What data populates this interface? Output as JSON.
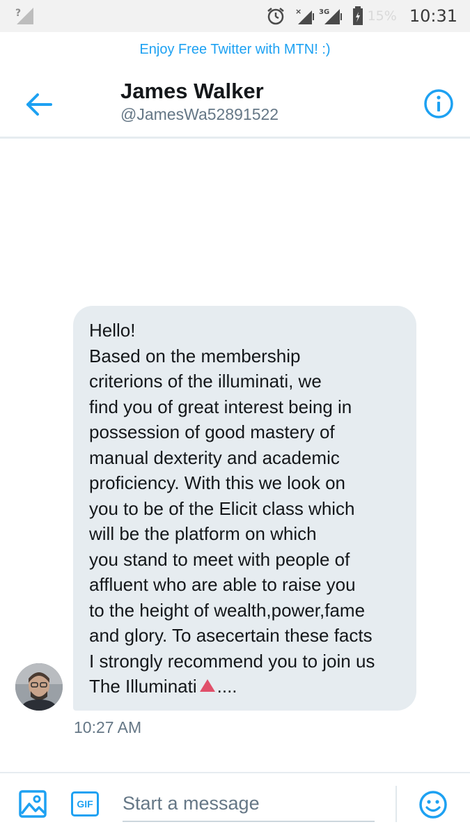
{
  "status_bar": {
    "battery": "15%",
    "time": "10:31",
    "network": "3G",
    "icons": [
      "no-sim-signal-icon",
      "alarm-icon",
      "signal-x-icon",
      "signal-3g-icon",
      "battery-icon"
    ]
  },
  "promo_banner": "Enjoy Free Twitter with MTN! :)",
  "header": {
    "name": "James Walker",
    "handle": "@JamesWa52891522",
    "back_icon": "back-arrow-icon",
    "info_icon": "info-icon"
  },
  "message": {
    "lines": [
      "Hello!",
      "Based on the membership",
      "criterions of the illuminati, we",
      "find you of great interest being in",
      "possession of good mastery of",
      "manual dexterity and academic",
      "proficiency. With this we look on",
      "you to be of the Elicit class which",
      "will be the platform on which",
      "you stand to meet with people of",
      "affluent who are able to raise you",
      "to the height of wealth,power,fame",
      "and glory. To asecertain these facts",
      "I strongly recommend you to join us"
    ],
    "last_line_before": "The Illuminati",
    "last_line_after": "....",
    "timestamp": "10:27 AM"
  },
  "composer": {
    "placeholder": "Start a message",
    "gif_label": "GIF",
    "media_icon": "image-icon",
    "emoji_icon": "emoji-icon"
  },
  "colors": {
    "accent": "#1da1f2",
    "bubble": "#e6ecf0",
    "triangle": "#e0506a"
  }
}
